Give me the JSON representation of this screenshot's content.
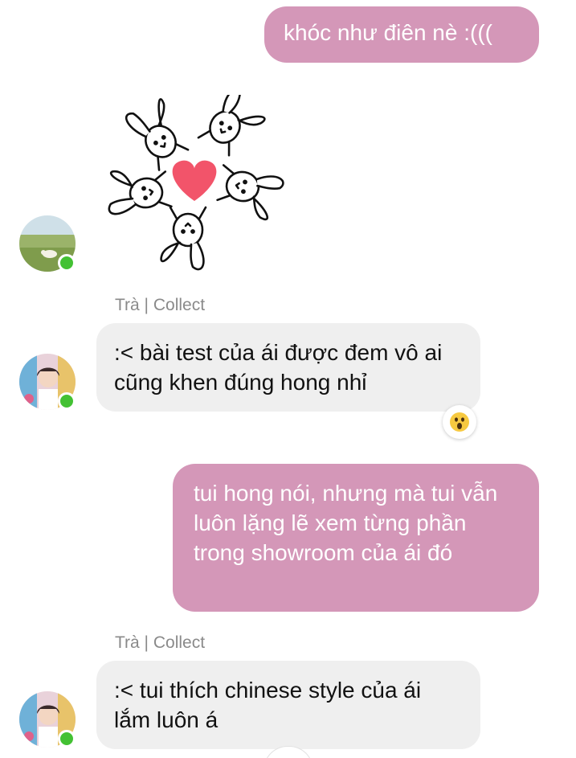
{
  "messages": [
    {
      "id": "m1",
      "direction": "outgoing",
      "text": "khóc như điên nè :((("
    },
    {
      "id": "m2",
      "direction": "incoming",
      "type": "sticker",
      "sticker_icon": "bunnies-heart-sticker"
    },
    {
      "id": "m3",
      "direction": "incoming",
      "sender": "Trà | Collect",
      "text": ":< bài test của ái được đem vô ai cũng khen đúng hong nhỉ",
      "reaction": "wow-emoji"
    },
    {
      "id": "m4",
      "direction": "outgoing",
      "text": "tui hong nói, nhưng mà tui vẫn luôn lặng lẽ xem từng phần trong showroom của ái đó"
    },
    {
      "id": "m5",
      "direction": "incoming",
      "sender": "Trà | Collect",
      "text": ":< tui thích chinese style của ái lắm luôn á"
    }
  ],
  "colors": {
    "outgoing_bubble": "#d497b8",
    "incoming_bubble": "#efefef",
    "online_status": "#43c133",
    "sticker_heart": "#f2546a",
    "sender_name": "#8a8a8a"
  }
}
